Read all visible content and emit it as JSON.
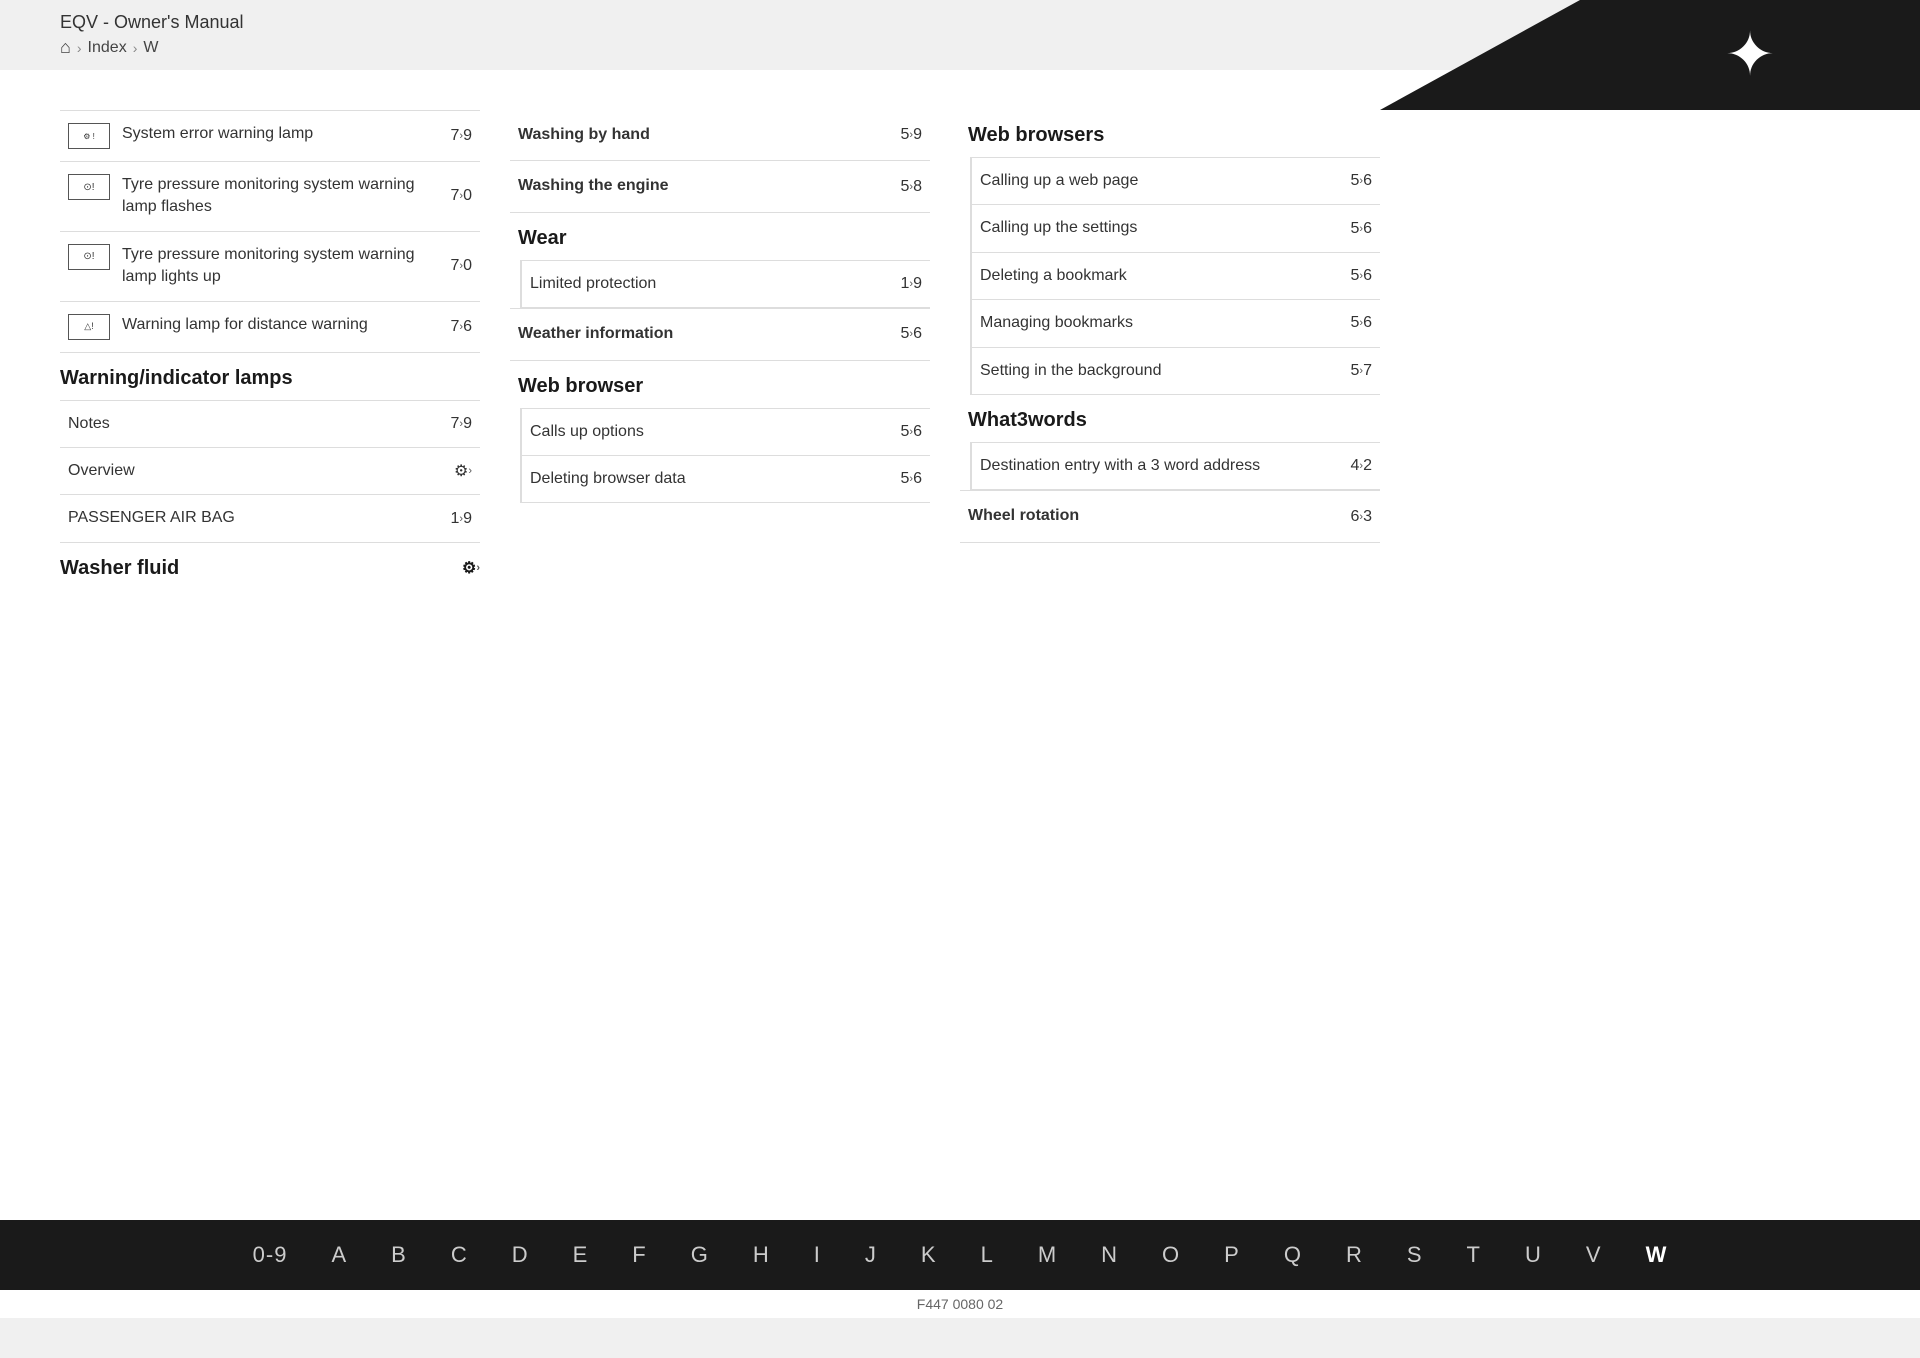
{
  "header": {
    "manual_title": "EQV - Owner's Manual",
    "breadcrumb": [
      "Index",
      "W"
    ]
  },
  "columns": [
    {
      "entries": [
        {
          "type": "icon-entry",
          "icon_label": "⚙️🔔",
          "icon_type": "system-error",
          "text": "System error warning lamp",
          "page": "7",
          "page2": "9"
        },
        {
          "type": "icon-entry",
          "icon_type": "tyre-pressure",
          "text": "Tyre pressure monitoring system warning lamp flashes",
          "page": "7",
          "page2": "0"
        },
        {
          "type": "icon-entry",
          "icon_type": "tyre-pressure",
          "text": "Tyre pressure monitoring system warning lamp lights up",
          "page": "7",
          "page2": "0"
        },
        {
          "type": "icon-entry",
          "icon_type": "distance-warning",
          "text": "Warning lamp for distance warning",
          "page": "7",
          "page2": "6"
        }
      ]
    },
    {
      "header_before": null,
      "entries": []
    }
  ],
  "section_warning_lamps": {
    "title": "Warning/indicator lamps",
    "entries": [
      {
        "text": "Notes",
        "page": "7",
        "page2": "9"
      },
      {
        "text": "Overview",
        "page": "⚙",
        "page2": ""
      },
      {
        "text": "PASSENGER AIR BAG",
        "page": "1",
        "page2": "9"
      }
    ]
  },
  "section_washer_fluid": {
    "title": "Washer fluid",
    "page": "⚙",
    "page2": ""
  },
  "col2": {
    "washing_by_hand": {
      "text": "Washing by hand",
      "page": "5",
      "page2": "9"
    },
    "washing_engine": {
      "text": "Washing the engine",
      "page": "5",
      "page2": "8"
    },
    "wear": {
      "title": "Wear",
      "sub": [
        {
          "text": "Limited protection",
          "page": "1",
          "page2": "9"
        }
      ]
    },
    "weather_info": {
      "text": "Weather information",
      "page": "5",
      "page2": "6"
    },
    "web_browser": {
      "title": "Web browser",
      "sub": [
        {
          "text": "Calls up options",
          "page": "5",
          "page2": "6"
        },
        {
          "text": "Deleting browser data",
          "page": "5",
          "page2": "6"
        }
      ]
    }
  },
  "col3": {
    "web_browsers": {
      "title": "Web browsers",
      "sub": [
        {
          "text": "Calling up a web page",
          "page": "5",
          "page2": "6"
        },
        {
          "text": "Calling up the settings",
          "page": "5",
          "page2": "6"
        },
        {
          "text": "Deleting a bookmark",
          "page": "5",
          "page2": "6"
        },
        {
          "text": "Managing bookmarks",
          "page": "5",
          "page2": "6"
        },
        {
          "text": "Setting in the background",
          "page": "5",
          "page2": "7"
        }
      ]
    },
    "what3words": {
      "title": "What3words",
      "sub": [
        {
          "text": "Destination entry with a 3 word address",
          "page": "4",
          "page2": "2"
        }
      ]
    },
    "wheel_rotation": {
      "text": "Wheel rotation",
      "page": "6",
      "page2": "3"
    }
  },
  "alphabet": [
    "0-9",
    "A",
    "B",
    "C",
    "D",
    "E",
    "F",
    "G",
    "H",
    "I",
    "J",
    "K",
    "L",
    "M",
    "N",
    "O",
    "P",
    "Q",
    "R",
    "S",
    "T",
    "U",
    "V",
    "W"
  ],
  "active_letter": "W",
  "footer_code": "F447 0080 02"
}
